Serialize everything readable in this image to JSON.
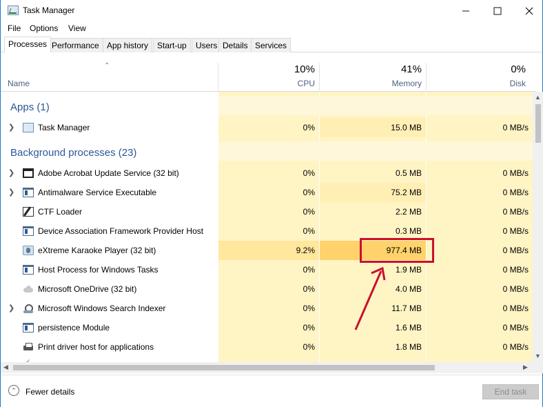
{
  "window": {
    "title": "Task Manager",
    "icons": {
      "minimize": "minimize-icon",
      "maximize": "maximize-icon",
      "close": "close-icon"
    }
  },
  "menu": [
    "File",
    "Options",
    "View"
  ],
  "tabs": [
    "Processes",
    "Performance",
    "App history",
    "Start-up",
    "Users",
    "Details",
    "Services"
  ],
  "active_tab": "Processes",
  "columns": {
    "name": "Name",
    "cpu": {
      "percent": "10%",
      "label": "CPU"
    },
    "memory": {
      "percent": "41%",
      "label": "Memory"
    },
    "disk": {
      "percent": "0%",
      "label": "Disk"
    }
  },
  "groups": {
    "apps": "Apps (1)",
    "background": "Background processes (23)"
  },
  "apps": [
    {
      "name": "Task Manager",
      "cpu": "0%",
      "memory": "15.0 MB",
      "disk": "0 MB/s",
      "icon": "task-manager-icon",
      "expandable": true
    }
  ],
  "background": [
    {
      "name": "Adobe Acrobat Update Service (32 bit)",
      "cpu": "0%",
      "memory": "0.5 MB",
      "disk": "0 MB/s",
      "icon": "window-icon",
      "expandable": true
    },
    {
      "name": "Antimalware Service Executable",
      "cpu": "0%",
      "memory": "75.2 MB",
      "disk": "0 MB/s",
      "icon": "service-icon",
      "expandable": true
    },
    {
      "name": "CTF Loader",
      "cpu": "0%",
      "memory": "2.2 MB",
      "disk": "0 MB/s",
      "icon": "edit-icon",
      "expandable": false
    },
    {
      "name": "Device Association Framework Provider Host",
      "cpu": "0%",
      "memory": "0.3 MB",
      "disk": "0 MB/s",
      "icon": "service-icon",
      "expandable": false
    },
    {
      "name": "eXtreme Karaoke Player (32 bit)",
      "cpu": "9.2%",
      "memory": "977.4 MB",
      "disk": "0 MB/s",
      "icon": "karaoke-icon",
      "expandable": false
    },
    {
      "name": "Host Process for Windows Tasks",
      "cpu": "0%",
      "memory": "1.9 MB",
      "disk": "0 MB/s",
      "icon": "service-icon",
      "expandable": false
    },
    {
      "name": "Microsoft OneDrive (32 bit)",
      "cpu": "0%",
      "memory": "4.0 MB",
      "disk": "0 MB/s",
      "icon": "cloud-icon",
      "expandable": false
    },
    {
      "name": "Microsoft Windows Search Indexer",
      "cpu": "0%",
      "memory": "11.7 MB",
      "disk": "0 MB/s",
      "icon": "search-indexer-icon",
      "expandable": true
    },
    {
      "name": "persistence Module",
      "cpu": "0%",
      "memory": "1.6 MB",
      "disk": "0 MB/s",
      "icon": "service-icon",
      "expandable": false
    },
    {
      "name": "Print driver host for applications",
      "cpu": "0%",
      "memory": "1.8 MB",
      "disk": "0 MB/s",
      "icon": "printer-icon",
      "expandable": false
    }
  ],
  "footer": {
    "fewer_details": "Fewer details",
    "end_task": "End task"
  },
  "colors": {
    "heat_low": "#fff4c4",
    "heat_mid": "#ffe79d",
    "heat_high": "#ffd26b",
    "group_text": "#2b5797",
    "annotation": "#c8102e"
  }
}
